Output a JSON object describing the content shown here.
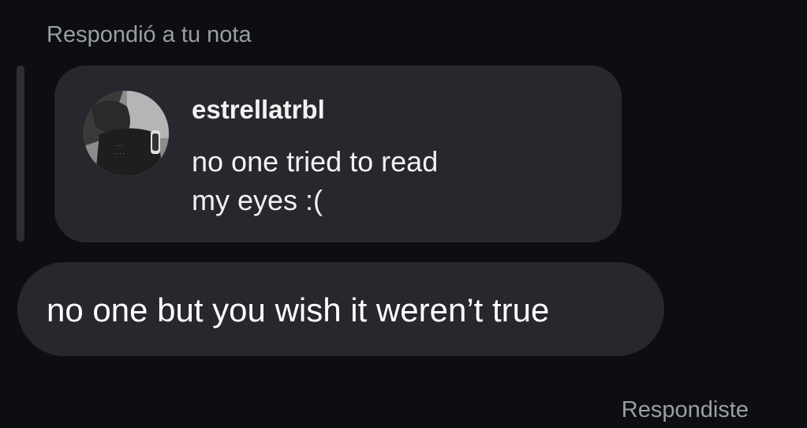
{
  "header": {
    "replied_label": "Respondió a tu nota"
  },
  "note": {
    "username": "estrellatrbl",
    "text_line1": "no one tried to read",
    "text_line2": "my eyes :(",
    "avatar_icon": "profile-photo"
  },
  "message": {
    "text": "no one but you wish it weren’t true"
  },
  "footer": {
    "status_label": "Respondiste"
  },
  "colors": {
    "background": "#0d0e12",
    "bubble": "#26282d",
    "muted_text": "#9a9da4",
    "primary_text": "#ffffff"
  }
}
